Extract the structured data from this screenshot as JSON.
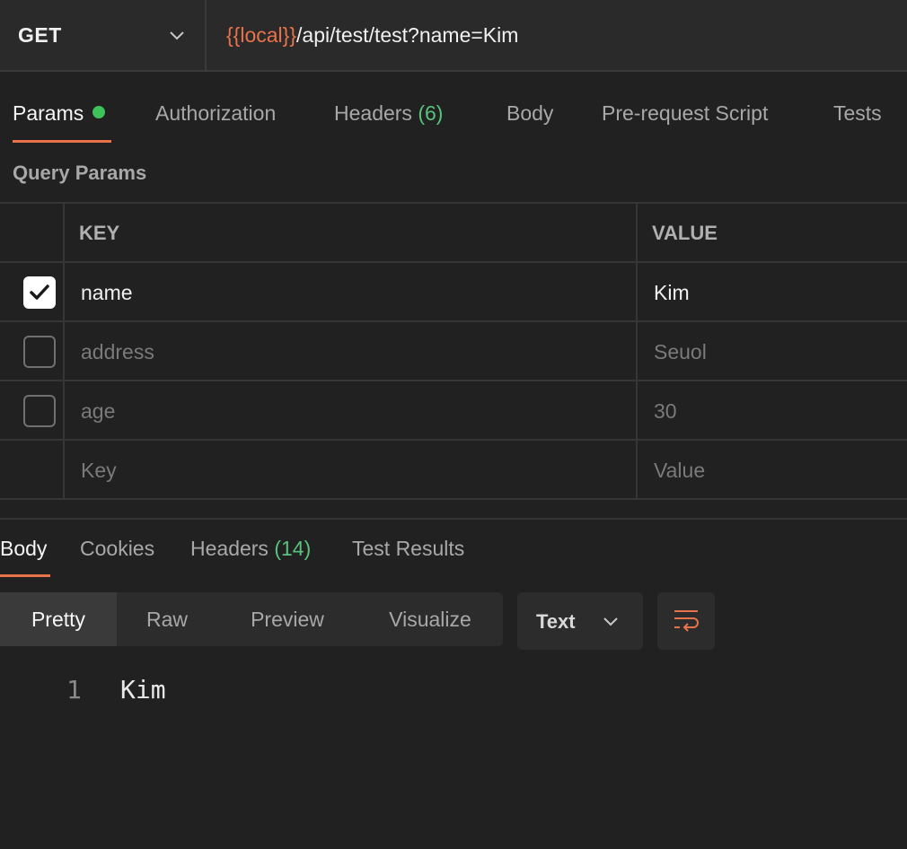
{
  "request": {
    "method": "GET",
    "url_variable": "{{local}}",
    "url_path": "/api/test/test?name=Kim"
  },
  "request_tabs": [
    {
      "label": "Params",
      "active": true
    },
    {
      "label": "Authorization"
    },
    {
      "label": "Headers",
      "count": "(6)"
    },
    {
      "label": "Body"
    },
    {
      "label": "Pre-request Script"
    },
    {
      "label": "Tests"
    }
  ],
  "query_params": {
    "title": "Query Params",
    "headers": {
      "key": "KEY",
      "value": "VALUE"
    },
    "rows": [
      {
        "key": "name",
        "value": "Kim",
        "checked": true
      },
      {
        "key": "address",
        "value": "Seuol",
        "checked": false
      },
      {
        "key": "age",
        "value": "30",
        "checked": false
      }
    ],
    "placeholder": {
      "key": "Key",
      "value": "Value"
    }
  },
  "response_tabs": [
    {
      "label": "Body",
      "active": true
    },
    {
      "label": "Cookies"
    },
    {
      "label": "Headers",
      "count": "(14)"
    },
    {
      "label": "Test Results"
    }
  ],
  "view_modes": [
    {
      "label": "Pretty",
      "active": true
    },
    {
      "label": "Raw"
    },
    {
      "label": "Preview"
    },
    {
      "label": "Visualize"
    }
  ],
  "format": "Text",
  "response_body": {
    "line_number": "1",
    "code": "Kim"
  },
  "colors": {
    "accent": "#e8734a",
    "status_green": "#3ec35a",
    "count_green": "#58c27d",
    "background": "#212121"
  },
  "icons": {
    "method_dropdown": "chevron-down-icon",
    "format_dropdown": "chevron-down-icon",
    "wrap": "wrap-lines-icon",
    "checkbox": "check-icon"
  }
}
